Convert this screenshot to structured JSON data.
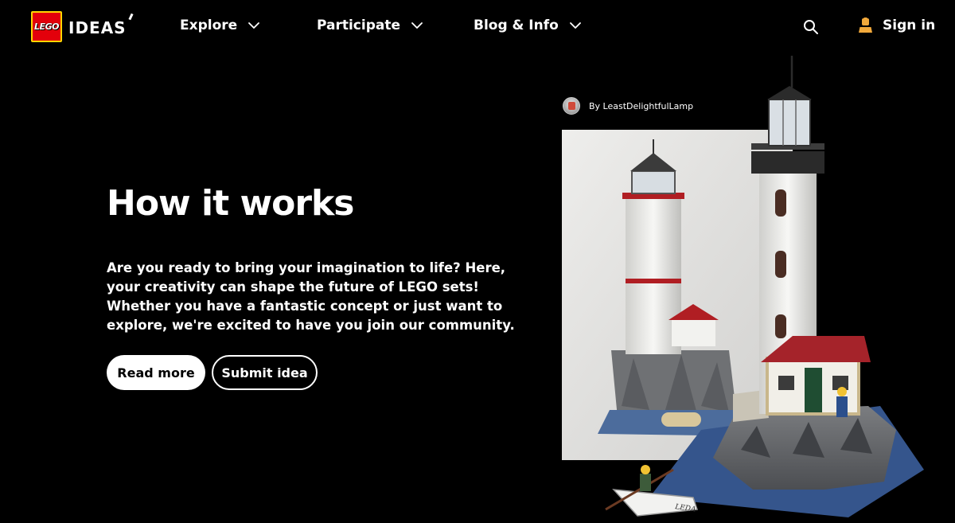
{
  "header": {
    "logo_badge_text": "LEGO",
    "logo_word": "IDEAS",
    "nav": [
      {
        "label": "Explore"
      },
      {
        "label": "Participate"
      },
      {
        "label": "Blog & Info"
      }
    ],
    "search_icon": "search-icon",
    "sign_in_icon": "user-icon",
    "sign_in_label": "Sign in"
  },
  "hero": {
    "title": "How it works",
    "description": "Are you ready to bring your imagination to life? Here, your creativity can shape the future of LEGO sets! Whether you have a fantastic concept or just want to explore, we're excited to have you join our community.",
    "primary_button": "Read more",
    "secondary_button": "Submit idea"
  },
  "featured": {
    "author_label": "By LeastDelightfulLamp",
    "boat_label": "LEDA"
  },
  "colors": {
    "background": "#000000",
    "text": "#ffffff",
    "lego_red": "#e3000b",
    "lego_yellow": "#ffd500",
    "user_icon": "#f2a93b"
  }
}
